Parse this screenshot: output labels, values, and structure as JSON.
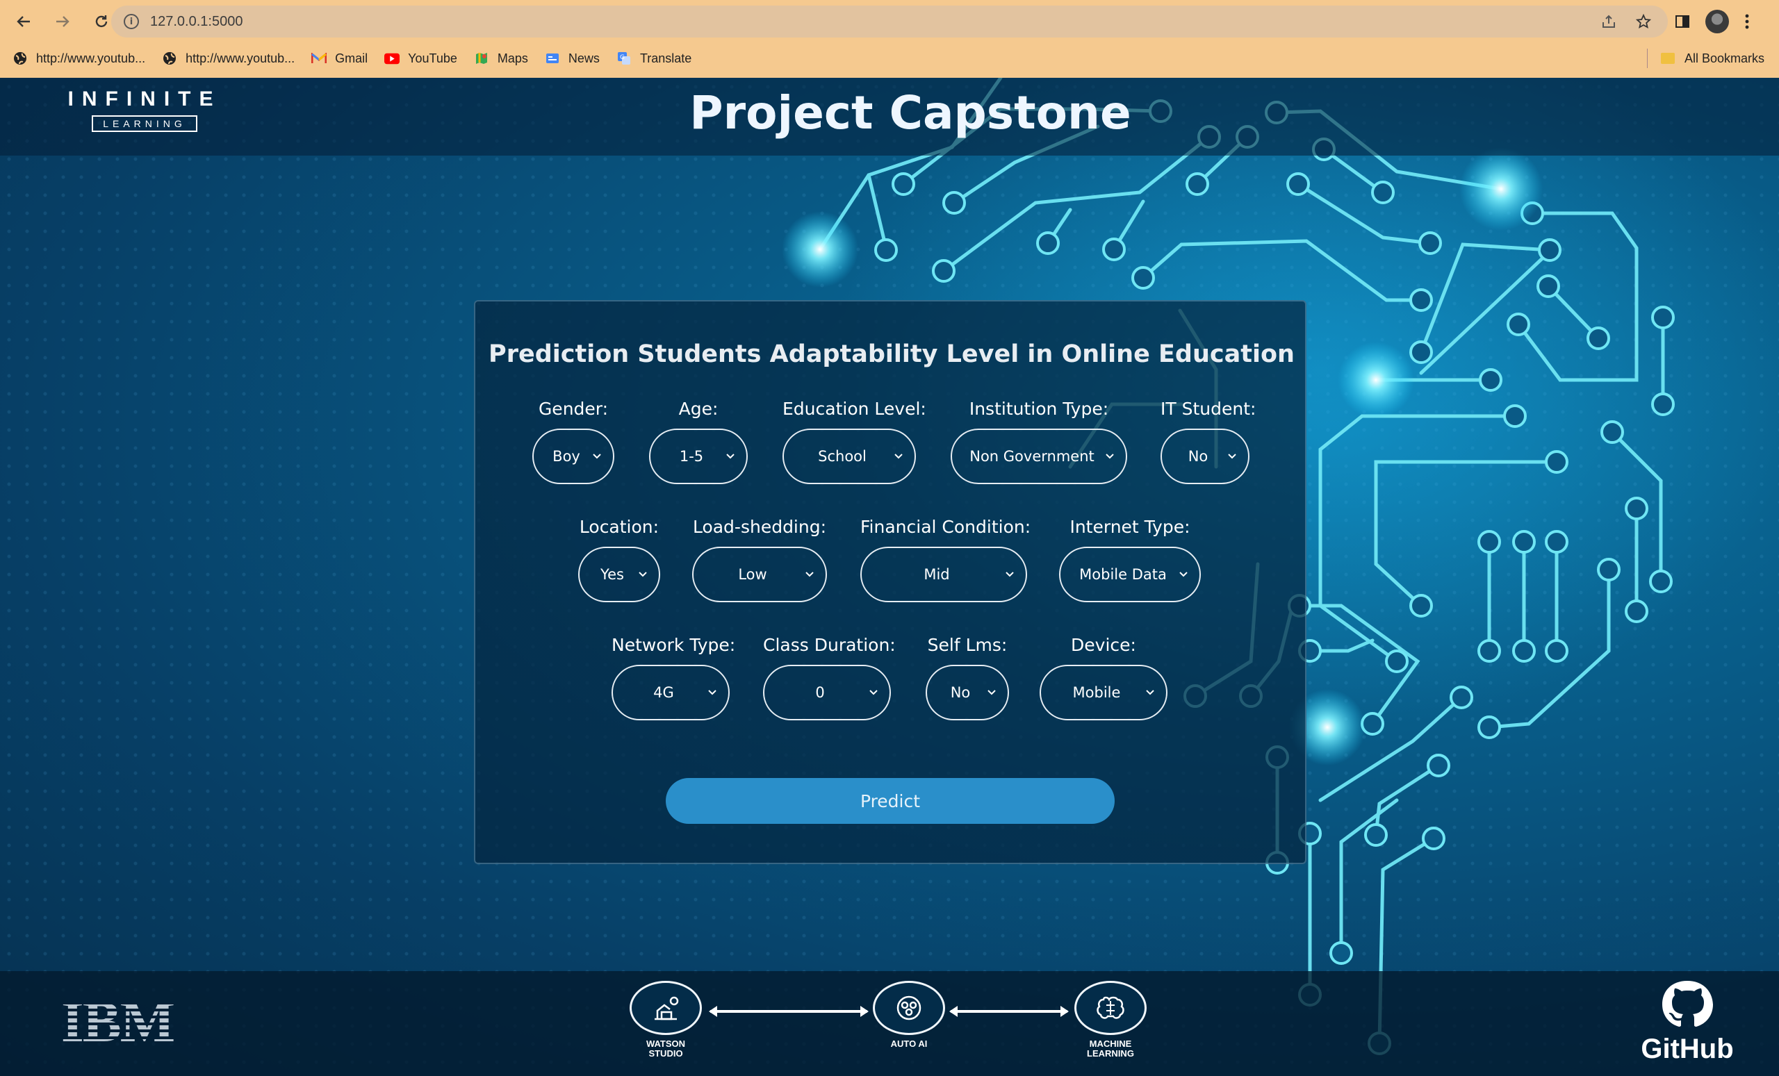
{
  "browser": {
    "url": "127.0.0.1:5000",
    "bookmarks": [
      {
        "label": "http://www.youtub...",
        "icon": "globe-icon"
      },
      {
        "label": "http://www.youtub...",
        "icon": "globe-icon"
      },
      {
        "label": "Gmail",
        "icon": "gmail-icon"
      },
      {
        "label": "YouTube",
        "icon": "youtube-icon"
      },
      {
        "label": "Maps",
        "icon": "maps-icon"
      },
      {
        "label": "News",
        "icon": "news-icon"
      },
      {
        "label": "Translate",
        "icon": "translate-icon"
      }
    ],
    "all_bookmarks": "All Bookmarks"
  },
  "header": {
    "logo_main": "INFINITE",
    "logo_sub": "LEARNING",
    "title": "Project Capstone"
  },
  "form": {
    "title": "Prediction Students Adaptability Level in Online Education",
    "fields": [
      {
        "label": "Gender:",
        "value": "Boy"
      },
      {
        "label": "Age:",
        "value": "1-5"
      },
      {
        "label": "Education Level:",
        "value": "School"
      },
      {
        "label": "Institution Type:",
        "value": "Non Government"
      },
      {
        "label": "IT Student:",
        "value": "No"
      },
      {
        "label": "Location:",
        "value": "Yes"
      },
      {
        "label": "Load-shedding:",
        "value": "Low"
      },
      {
        "label": "Financial Condition:",
        "value": "Mid"
      },
      {
        "label": "Internet Type:",
        "value": "Mobile Data"
      },
      {
        "label": "Network Type:",
        "value": "4G"
      },
      {
        "label": "Class Duration:",
        "value": "0"
      },
      {
        "label": "Self Lms:",
        "value": "No"
      },
      {
        "label": "Device:",
        "value": "Mobile"
      }
    ],
    "submit_label": "Predict"
  },
  "footer": {
    "ibm_logo": "IBM",
    "pipeline": [
      {
        "label_line1": "WATSON",
        "label_line2": "STUDIO",
        "icon": "watson-studio-icon"
      },
      {
        "label_line1": "AUTO AI",
        "label_line2": "",
        "icon": "auto-ai-icon"
      },
      {
        "label_line1": "MACHINE",
        "label_line2": "LEARNING",
        "icon": "machine-learning-icon"
      }
    ],
    "github_label": "GitHub"
  },
  "colors": {
    "chrome": "#f5c98f",
    "accent_button": "#2a8fca",
    "circuit_glow": "#5ee8ff"
  }
}
